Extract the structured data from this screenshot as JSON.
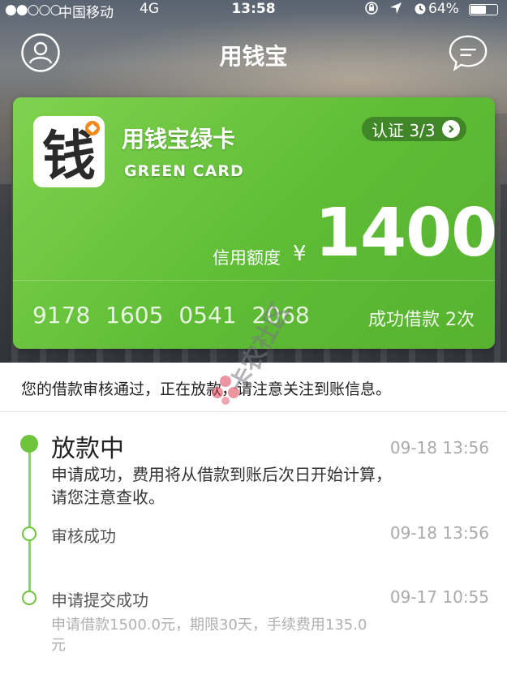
{
  "status_bar": {
    "signal": "●●○○○",
    "carrier": "中国移动",
    "network": "4G",
    "time": "13:58",
    "battery_pct": "64%",
    "battery_level": 0.64
  },
  "header": {
    "title": "用钱宝"
  },
  "card": {
    "logo_char": "钱",
    "name": "用钱宝绿卡",
    "subtitle": "GREEN CARD",
    "verify_label": "认证 3/3",
    "limit_label": "信用额度",
    "currency": "¥",
    "amount": "1400",
    "number": "9178 1605 0541 2068",
    "success_label": "成功借款 2次",
    "color": "#6cc63f"
  },
  "watermark": {
    "text": "卡农社区"
  },
  "notice": {
    "text": "您的借款审核通过，正在放款，请注意关注到账信息。"
  },
  "timeline": {
    "accent": "#6fc43d",
    "items": [
      {
        "title": "放款中",
        "time": "09-18 13:56",
        "desc": "申请成功，费用将从借款到账后次日开始计算，请您注意查收。"
      },
      {
        "title": "审核成功",
        "time": "09-18 13:56"
      },
      {
        "title": "申请提交成功",
        "time": "09-17 10:55",
        "note": "申请借款1500.0元，期限30天，手续费用135.0元"
      }
    ]
  }
}
